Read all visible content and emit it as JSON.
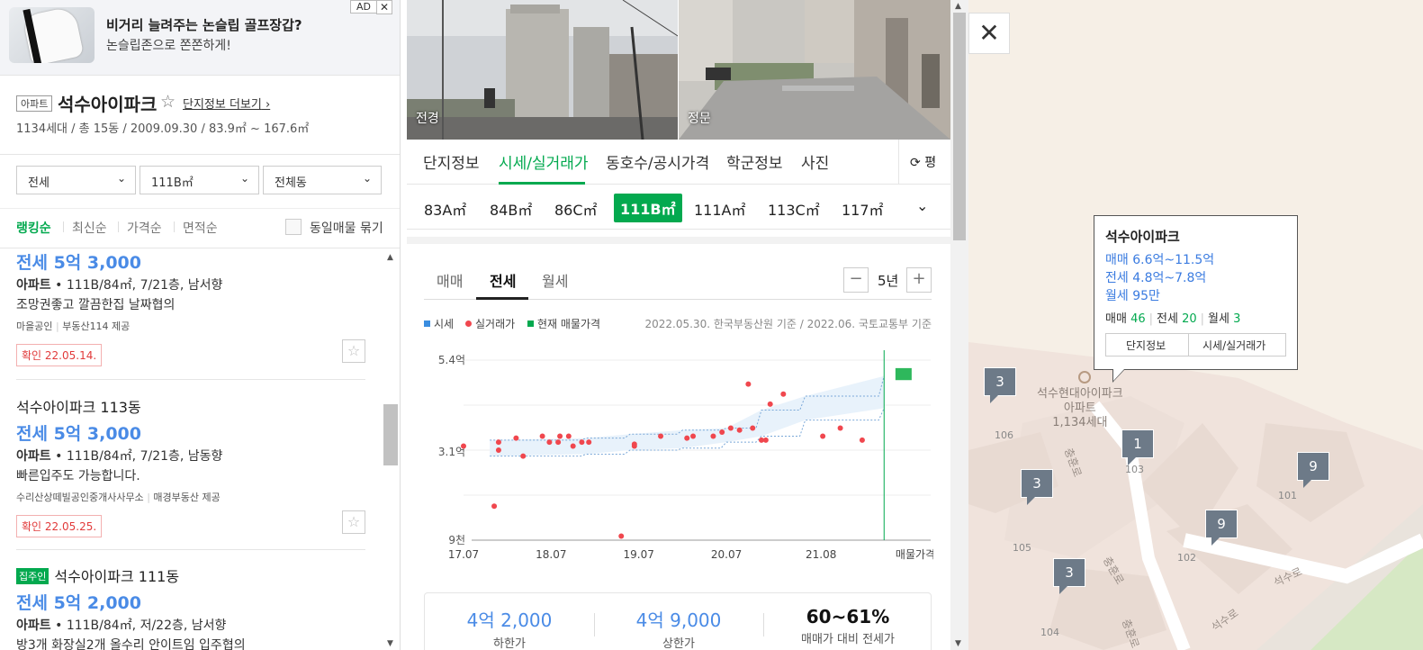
{
  "ad": {
    "badge": "AD",
    "close": "✕",
    "title": "비거리 늘려주는 논슬립 골프장갑?",
    "subtitle": "논슬립존으로 쫀쫀하게!"
  },
  "complex": {
    "type": "아파트",
    "name": "석수아이파크",
    "star": "☆",
    "more": "단지정보 더보기",
    "info": "1134세대 / 총 15동 / 2009.09.30 / 83.9㎡ ~ 167.6㎡"
  },
  "filters": {
    "trade": "전세",
    "area": "111B㎡",
    "dong": "전체동"
  },
  "sorts": {
    "items": [
      "랭킹순",
      "최신순",
      "가격순",
      "면적순"
    ],
    "group_label": "동일매물 묶기"
  },
  "listings": [
    {
      "price": "전세 5억 3,000",
      "spec_type": "아파트",
      "spec": "111B/84㎡, 7/21층, 남서향",
      "desc": "조망권좋고 깔끔한집 날짜협의",
      "agent1": "마을공인",
      "agent2": "부동산114 제공",
      "confirm": "확인 22.05.14."
    },
    {
      "title": "석수아이파크 113동",
      "price": "전세 5억 3,000",
      "spec_type": "아파트",
      "spec": "111B/84㎡, 7/21층, 남동향",
      "desc": "빠른입주도 가능합니다.",
      "agent1": "수리산상떼빌공인중개사사무소",
      "agent2": "매경부동산 제공",
      "confirm": "확인 22.05.25."
    },
    {
      "badge": "집주인",
      "title": "석수아이파크 111동",
      "price": "전세 5억 2,000",
      "spec_type": "아파트",
      "spec": "111B/84㎡, 저/22층, 남서향",
      "desc": "방3개 화장실2개 올수리 안이트임 입주협의"
    }
  ],
  "photos": {
    "left_label": "전경",
    "right_label": "정문"
  },
  "tabs": {
    "items": [
      "단지정보",
      "시세/실거래가",
      "동호수/공시가격",
      "학군정보",
      "사진"
    ],
    "active": "시세/실거래가",
    "pyeong": "평"
  },
  "sizes": {
    "items": [
      "83A㎡",
      "84B㎡",
      "86C㎡",
      "111B㎡",
      "111A㎡",
      "113C㎡",
      "117㎡"
    ],
    "active": "111B㎡"
  },
  "deal_tabs": {
    "items": [
      "매매",
      "전세",
      "월세"
    ],
    "active": "전세",
    "period": "5년",
    "minus": "−",
    "plus": "+"
  },
  "legend": {
    "items": [
      "시세",
      "실거래가",
      "현재 매물가격"
    ],
    "note": "2022.05.30. 한국부동산원 기준 / 2022.06. 국토교통부 기준"
  },
  "colors": {
    "accent": "#03a94f",
    "price_blue": "#4a8be6",
    "dot_red": "#f0474e",
    "band_fill": "#e8f2fb",
    "band_line": "#7aa8d8",
    "marker": "#6d7a88"
  },
  "chart_data": {
    "type": "scatter",
    "y_tick_labels": [
      "5.4억",
      "3.1억",
      "9천"
    ],
    "y_tick_values": [
      5.4,
      3.1,
      0.9
    ],
    "ylim": [
      0.9,
      5.4
    ],
    "x_tick_labels": [
      "17.07",
      "18.07",
      "19.07",
      "20.07",
      "21.08",
      "매물가격"
    ],
    "x_tick_values": [
      2017.5,
      2018.5,
      2019.5,
      2020.5,
      2021.58
    ],
    "xlim": [
      2017.5,
      2022.4
    ],
    "listing_marker_x": 2022.45,
    "listing_marker_y": [
      4.9,
      5.2
    ],
    "listing_line_x": 2022.3,
    "series": [
      {
        "name": "실거래가",
        "points": [
          [
            2017.5,
            3.25
          ],
          [
            2017.85,
            1.75
          ],
          [
            2017.9,
            3.35
          ],
          [
            2017.9,
            3.15
          ],
          [
            2018.1,
            3.45
          ],
          [
            2018.18,
            3.0
          ],
          [
            2018.4,
            3.5
          ],
          [
            2018.48,
            3.35
          ],
          [
            2018.58,
            3.35
          ],
          [
            2018.6,
            3.5
          ],
          [
            2018.7,
            3.5
          ],
          [
            2018.75,
            3.25
          ],
          [
            2018.85,
            3.35
          ],
          [
            2018.93,
            3.35
          ],
          [
            2019.3,
            1.0
          ],
          [
            2019.45,
            3.3
          ],
          [
            2019.45,
            3.25
          ],
          [
            2019.75,
            3.5
          ],
          [
            2020.05,
            3.45
          ],
          [
            2020.12,
            3.5
          ],
          [
            2020.35,
            3.5
          ],
          [
            2020.45,
            3.6
          ],
          [
            2020.55,
            3.7
          ],
          [
            2020.65,
            3.65
          ],
          [
            2020.75,
            4.8
          ],
          [
            2020.8,
            3.7
          ],
          [
            2020.9,
            3.4
          ],
          [
            2020.95,
            3.4
          ],
          [
            2021.0,
            4.3
          ],
          [
            2021.15,
            4.55
          ],
          [
            2021.6,
            3.5
          ],
          [
            2021.8,
            3.7
          ],
          [
            2022.05,
            3.4
          ]
        ]
      },
      {
        "name": "시세",
        "upper": [
          [
            2017.8,
            3.4
          ],
          [
            2018.9,
            3.45
          ],
          [
            2019.4,
            3.55
          ],
          [
            2020.0,
            3.65
          ],
          [
            2020.5,
            3.7
          ],
          [
            2020.9,
            4.15
          ],
          [
            2021.4,
            4.5
          ],
          [
            2022.3,
            5.0
          ]
        ],
        "lower": [
          [
            2017.8,
            3.0
          ],
          [
            2018.9,
            3.05
          ],
          [
            2019.4,
            3.15
          ],
          [
            2020.0,
            3.2
          ],
          [
            2020.5,
            3.35
          ],
          [
            2020.9,
            3.5
          ],
          [
            2021.4,
            3.9
          ],
          [
            2022.3,
            4.2
          ]
        ]
      }
    ]
  },
  "stats": [
    {
      "value": "4억 2,000",
      "label": "하한가"
    },
    {
      "value": "4억 9,000",
      "label": "상한가"
    },
    {
      "value": "60~61%",
      "label": "매매가 대비 전세가"
    }
  ],
  "map": {
    "close": "✕",
    "popup": {
      "title": "석수아이파크",
      "sale": "매매 6.6억~11.5억",
      "jeonse": "전세 4.8억~7.8억",
      "wolse": "월세 95만",
      "count_sale_label": "매매",
      "count_sale": "46",
      "count_jeonse_label": "전세",
      "count_jeonse": "20",
      "count_wolse_label": "월세",
      "count_wolse": "3",
      "btn_info": "단지정보",
      "btn_price": "시세/실거래가"
    },
    "place_name": "석수현대아이파크",
    "place_type": "아파트",
    "place_households": "1,134세대",
    "markers": [
      "3",
      "1",
      "3",
      "9",
      "9",
      "3"
    ],
    "buildings": [
      "106",
      "103",
      "105",
      "101",
      "102",
      "104"
    ],
    "roads": [
      "충훈로",
      "충훈로",
      "석수로",
      "석수로",
      "충훈로"
    ]
  }
}
